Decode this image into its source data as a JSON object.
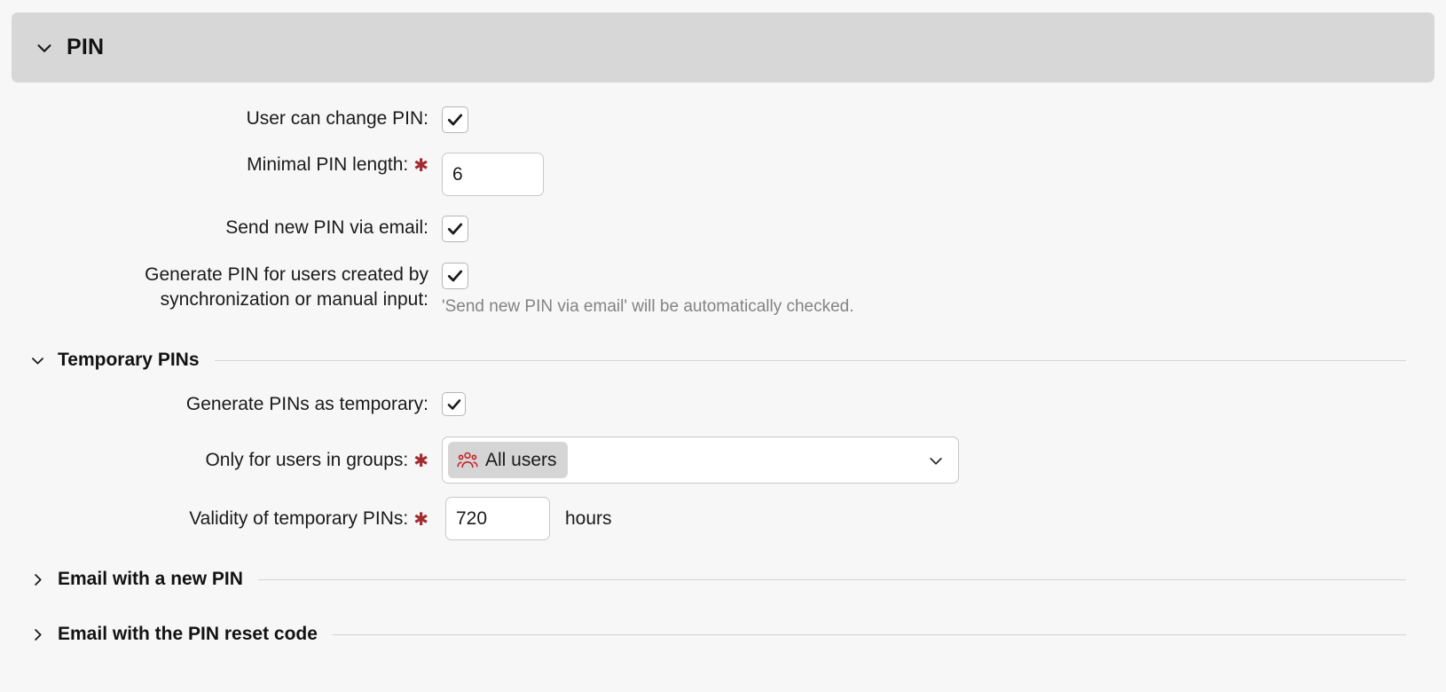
{
  "panel": {
    "title": "PIN",
    "expanded_icon": "chevron-down-icon"
  },
  "fields": {
    "user_can_change": {
      "label": "User can change PIN:",
      "checked": true
    },
    "minimal_length": {
      "label": "Minimal PIN length:",
      "required_marker": "✱",
      "value": "6"
    },
    "send_via_email": {
      "label": "Send new PIN via email:",
      "checked": true
    },
    "generate_for_created": {
      "label_line1": "Generate PIN for users created by",
      "label_line2": "synchronization or manual input:",
      "checked": true,
      "hint": "'Send new PIN via email' will be automatically checked."
    }
  },
  "temporary_section": {
    "title": "Temporary PINs",
    "icon": "chevron-down-icon",
    "generate_as_temporary": {
      "label": "Generate PINs as temporary:",
      "checked": true
    },
    "only_for_groups": {
      "label": "Only for users in groups:",
      "required_marker": "✱",
      "chip_label": "All users",
      "chip_icon": "users-group-icon",
      "chevron": "chevron-down-icon"
    },
    "validity": {
      "label": "Validity of temporary PINs:",
      "required_marker": "✱",
      "value": "720",
      "suffix": "hours"
    }
  },
  "collapsed_sections": [
    {
      "title": "Email with a new PIN",
      "icon": "chevron-right-icon"
    },
    {
      "title": "Email with the PIN reset code",
      "icon": "chevron-right-icon"
    }
  ],
  "colors": {
    "page_background": "#f7f7f7",
    "header_background": "#d7d7d7",
    "required_marker": "#a32b30",
    "group_icon": "#c6262c",
    "hint_text": "#838383",
    "chip_background": "#d5d5d5",
    "divider": "#d4d4d4"
  }
}
